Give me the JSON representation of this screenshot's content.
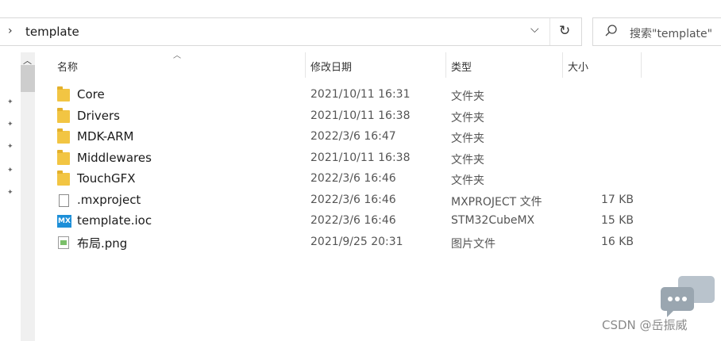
{
  "address_bar": {
    "path": "template"
  },
  "search": {
    "placeholder": "搜索\"template\""
  },
  "columns": {
    "name": "名称",
    "date": "修改日期",
    "type": "类型",
    "size": "大小"
  },
  "files": [
    {
      "name": "Core",
      "date": "2021/10/11 16:31",
      "type": "文件夹",
      "size": "",
      "icon": "folder-icon"
    },
    {
      "name": "Drivers",
      "date": "2021/10/11 16:38",
      "type": "文件夹",
      "size": "",
      "icon": "folder-icon"
    },
    {
      "name": "MDK-ARM",
      "date": "2022/3/6 16:47",
      "type": "文件夹",
      "size": "",
      "icon": "folder-icon"
    },
    {
      "name": "Middlewares",
      "date": "2021/10/11 16:38",
      "type": "文件夹",
      "size": "",
      "icon": "folder-icon"
    },
    {
      "name": "TouchGFX",
      "date": "2022/3/6 16:46",
      "type": "文件夹",
      "size": "",
      "icon": "folder-icon"
    },
    {
      "name": ".mxproject",
      "date": "2022/3/6 16:46",
      "type": "MXPROJECT 文件",
      "size": "17 KB",
      "icon": "blank-file-icon"
    },
    {
      "name": "template.ioc",
      "date": "2022/3/6 16:46",
      "type": "STM32CubeMX",
      "size": "15 KB",
      "icon": "stm32cubemx-icon",
      "icon_label": "MX"
    },
    {
      "name": "布局.png",
      "date": "2021/9/25 20:31",
      "type": "图片文件",
      "size": "16 KB",
      "icon": "image-file-icon"
    }
  ],
  "watermark": {
    "text": "CSDN @岳振威"
  }
}
